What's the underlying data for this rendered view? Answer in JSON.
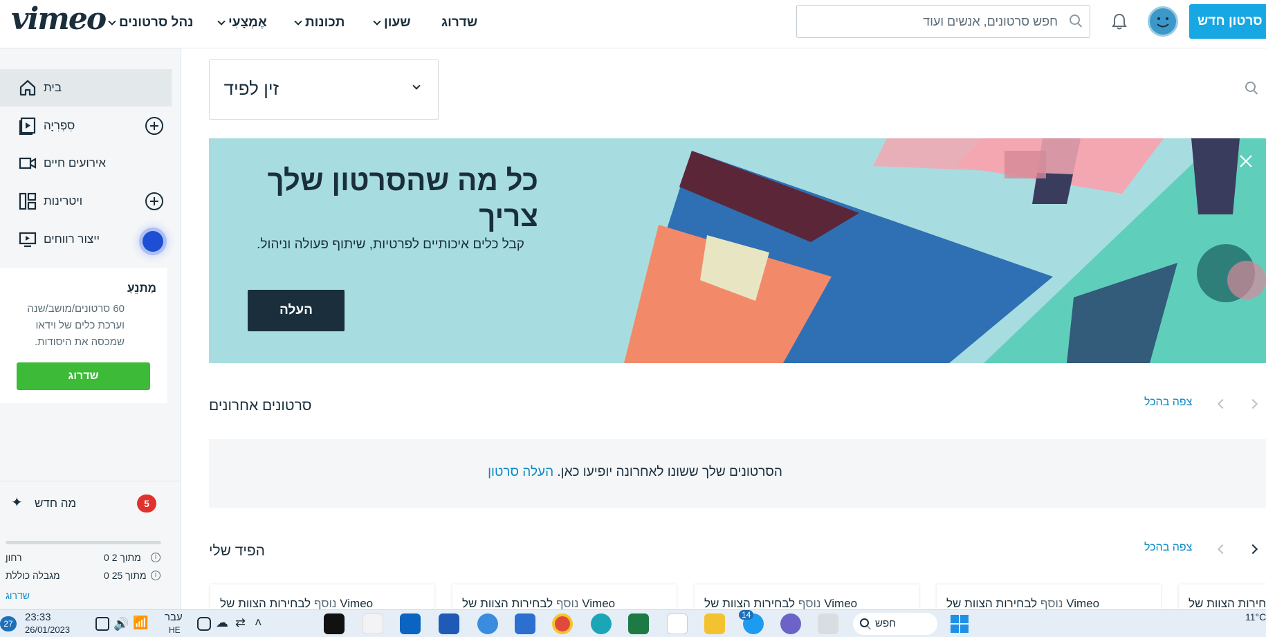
{
  "header": {
    "logo": "vimeo",
    "nav": {
      "manage": "נהל סרטונים",
      "tools": "אֶמְצָעִי",
      "features": "תכונות",
      "watch": "שעון",
      "upgrade": "שדרוג"
    },
    "search_placeholder": "חפש סרטונים, אנשים ועוד",
    "new_video_label": "סרטון חדש"
  },
  "sidebar": {
    "items": [
      {
        "label": "בית",
        "icon": "home-icon"
      },
      {
        "label": "סִפְרִיָה",
        "icon": "library-icon"
      },
      {
        "label": "אירועים חיים",
        "icon": "camera-icon"
      },
      {
        "label": "ויטרינות",
        "icon": "showcase-icon"
      },
      {
        "label": "ייצור רווחים",
        "icon": "monetize-icon"
      }
    ],
    "plan": {
      "title": "מַתנֵעַ",
      "description": "60 סרטונים/מושב/שנה וערכת כלים של וידאו שמכסה את היסודות.",
      "button": "שדרוג"
    },
    "whats_new": {
      "label": "מה חדש",
      "count": "5"
    },
    "quota": [
      {
        "name": "ַרחון",
        "value": "0 מתוך 2"
      },
      {
        "name": "מגבלה כוללת",
        "value": "0 מתוך 25"
      }
    ],
    "quota_link": "שדרוג"
  },
  "main": {
    "feed_select": "זין לפיד",
    "banner": {
      "title": "כל מה שהסרטון שלך צריך",
      "subtitle": "קבל כלים איכותיים לפרטיות, שיתוף פעולה וניהול.",
      "button": "העלה"
    },
    "recent": {
      "title": "סרטונים אחרונים",
      "see_all": "צפה בהכל",
      "empty_message": "הסרטונים שלך ששונו לאחרונה יופיעו כאן.",
      "empty_link": "העלה סרטון"
    },
    "feed": {
      "title": "הפיד שלי",
      "see_all": "צפה בהכל",
      "cards": [
        {
          "brand": "Vimeo",
          "muted": "נוסף",
          "rest": "לבחירות הצוות של"
        },
        {
          "brand": "Vimeo",
          "muted": "נוסף",
          "rest": "לבחירות הצוות של"
        },
        {
          "brand": "Vimeo",
          "muted": "נוסף",
          "rest": "לבחירות הצוות של"
        },
        {
          "brand": "Vimeo",
          "muted": "נוסף",
          "rest": "לבחירות הצוות של"
        },
        {
          "brand": "",
          "muted": "",
          "rest": "לבחירות הצוות של"
        }
      ]
    }
  },
  "taskbar": {
    "temp_badge": "27",
    "time": "23:33",
    "date": "26/01/2023",
    "lang": "עבר",
    "lang_sub": "HE",
    "search": "חפש",
    "twitter_badge": "14",
    "weather": "11°C"
  },
  "colors": {
    "accent": "#17a7e3",
    "brand_dark": "#1a2e3b",
    "upgrade_green": "#3dba38",
    "banner_bg": "#a7dde0",
    "link": "#0a8ac8",
    "badge_red": "#e0322d"
  }
}
